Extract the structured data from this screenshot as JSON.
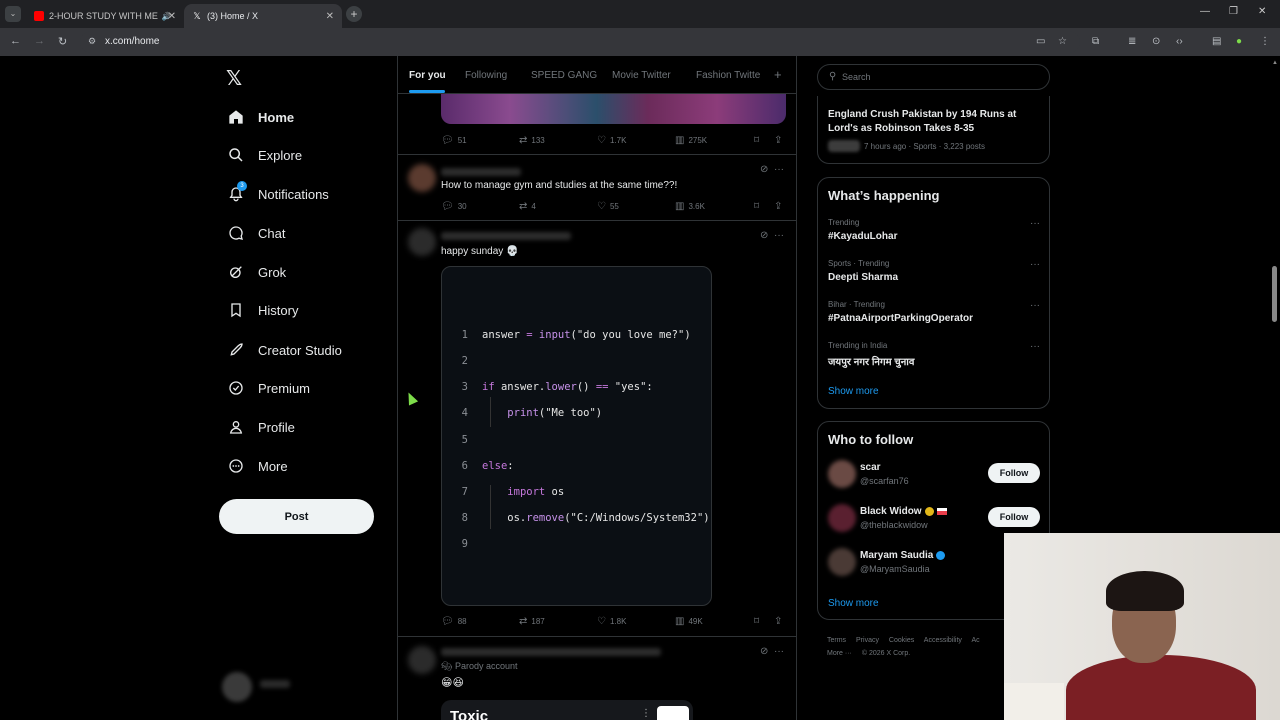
{
  "browser": {
    "tabs": [
      {
        "title": "2-HOUR STUDY WITH ME",
        "active": false,
        "favicon_color": "#ff0000"
      },
      {
        "title": "(3) Home / X",
        "active": true,
        "favicon_color": "#ffffff"
      }
    ],
    "url": "x.com/home"
  },
  "nav": {
    "logo": "𝕏",
    "items": [
      {
        "label": "Home",
        "icon": "home-icon",
        "active": true
      },
      {
        "label": "Explore",
        "icon": "search-icon"
      },
      {
        "label": "Notifications",
        "icon": "bell-icon",
        "badge": "3"
      },
      {
        "label": "Chat",
        "icon": "chat-icon"
      },
      {
        "label": "Grok",
        "icon": "grok-icon"
      },
      {
        "label": "History",
        "icon": "bookmark-icon"
      },
      {
        "label": "Creator Studio",
        "icon": "rocket-icon"
      },
      {
        "label": "Premium",
        "icon": "verified-icon"
      },
      {
        "label": "Profile",
        "icon": "person-icon"
      },
      {
        "label": "More",
        "icon": "more-icon"
      }
    ],
    "post_label": "Post"
  },
  "feed": {
    "tabs": [
      "For you",
      "Following",
      "SPEED GANG",
      "Movie Twitter",
      "Fashion Twitte"
    ],
    "active_tab": "For you",
    "post1": {
      "replies": "51",
      "reposts": "133",
      "likes": "1.7K",
      "views": "275K"
    },
    "post2": {
      "text": "How to manage gym and studies at the same time??!",
      "replies": "30",
      "reposts": "4",
      "likes": "55",
      "views": "3.6K"
    },
    "post3": {
      "text": "happy sunday 💀",
      "replies": "88",
      "reposts": "187",
      "likes": "1.8K",
      "views": "49K",
      "code_lines": [
        {
          "n": "1",
          "code": "answer = input(\"do you love me?\")"
        },
        {
          "n": "2",
          "code": ""
        },
        {
          "n": "3",
          "code": "if answer.lower() == \"yes\":"
        },
        {
          "n": "4",
          "code": "    print(\"Me too\")"
        },
        {
          "n": "5",
          "code": ""
        },
        {
          "n": "6",
          "code": "else:"
        },
        {
          "n": "7",
          "code": "    import os"
        },
        {
          "n": "8",
          "code": "    os.remove(\"C:/Windows/System32\")"
        },
        {
          "n": "9",
          "code": ""
        }
      ]
    },
    "post4": {
      "label": "Parody account",
      "emoji": "😁😆",
      "card_title": "Toxic"
    }
  },
  "right": {
    "search_placeholder": "Search",
    "news": {
      "title": "England Crush Pakistan by 194 Runs at Lord's as Robinson Takes 8-35",
      "meta": "7 hours ago · Sports · 3,223 posts"
    },
    "happening_title": "What’s happening",
    "trends": [
      {
        "category": "Trending",
        "name": "#KayaduLohar"
      },
      {
        "category": "Sports · Trending",
        "name": "Deepti Sharma"
      },
      {
        "category": "Bihar · Trending",
        "name": "#PatnaAirportParkingOperator"
      },
      {
        "category": "Trending in India",
        "name": "जयपुर नगर निगम चुनाव"
      }
    ],
    "show_more": "Show more",
    "wtf_title": "Who to follow",
    "follow_label": "Follow",
    "suggestions": [
      {
        "name": "scar",
        "handle": "@scarfan76"
      },
      {
        "name": "Black Widow",
        "handle": "@theblackwidow"
      },
      {
        "name": "Maryam Saudia",
        "handle": "@MaryamSaudia"
      }
    ],
    "footer": [
      "Terms",
      "Privacy",
      "Cookies",
      "Accessibility",
      "Ac",
      "More ···",
      "© 2026 X Corp."
    ]
  },
  "colors": {
    "accent": "#1d9bf0",
    "background": "#000000",
    "border": "#2f3336"
  }
}
